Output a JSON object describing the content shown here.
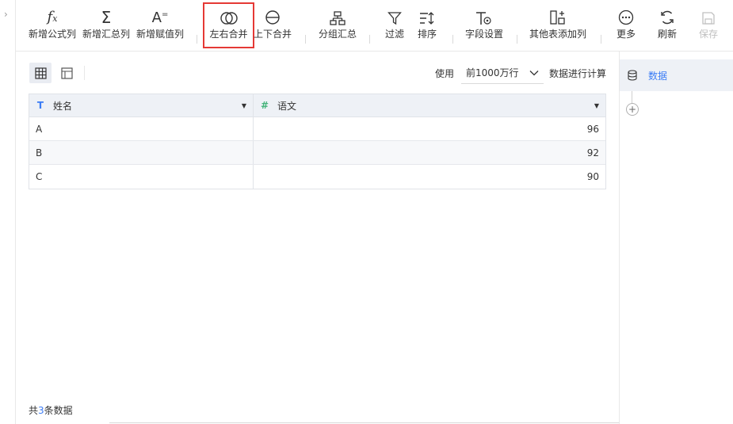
{
  "toolbar": {
    "items": [
      {
        "label": "新增公式列",
        "icon": "formula-icon"
      },
      {
        "label": "新增汇总列",
        "icon": "sigma-icon"
      },
      {
        "label": "新增赋值列",
        "icon": "assign-icon"
      },
      {
        "label": "左右合并",
        "icon": "join-icon",
        "active": true
      },
      {
        "label": "上下合并",
        "icon": "union-icon"
      },
      {
        "label": "分组汇总",
        "icon": "group-icon"
      },
      {
        "label": "过滤",
        "icon": "filter-icon"
      },
      {
        "label": "排序",
        "icon": "sort-icon"
      },
      {
        "label": "字段设置",
        "icon": "field-settings-icon"
      },
      {
        "label": "其他表添加列",
        "icon": "add-column-icon"
      },
      {
        "label": "更多",
        "icon": "more-icon"
      },
      {
        "label": "刷新",
        "icon": "refresh-icon"
      },
      {
        "label": "保存",
        "icon": "save-icon",
        "disabled": true
      }
    ]
  },
  "options": {
    "use_label": "使用",
    "row_limit": "前1000万行",
    "calc_label": "数据进行计算"
  },
  "table": {
    "columns": [
      {
        "name": "姓名",
        "type_icon": "T"
      },
      {
        "name": "语文",
        "type_icon": "#"
      }
    ],
    "rows": [
      [
        "A",
        "96"
      ],
      [
        "B",
        "92"
      ],
      [
        "C",
        "90"
      ]
    ]
  },
  "footer": {
    "prefix": "共",
    "count": "3",
    "suffix": "条数据"
  },
  "right_panel": {
    "dataset_label": "数据"
  },
  "colors": {
    "accent": "#3b7cf5",
    "active_border": "#e53935",
    "number_type": "#44b37a"
  }
}
